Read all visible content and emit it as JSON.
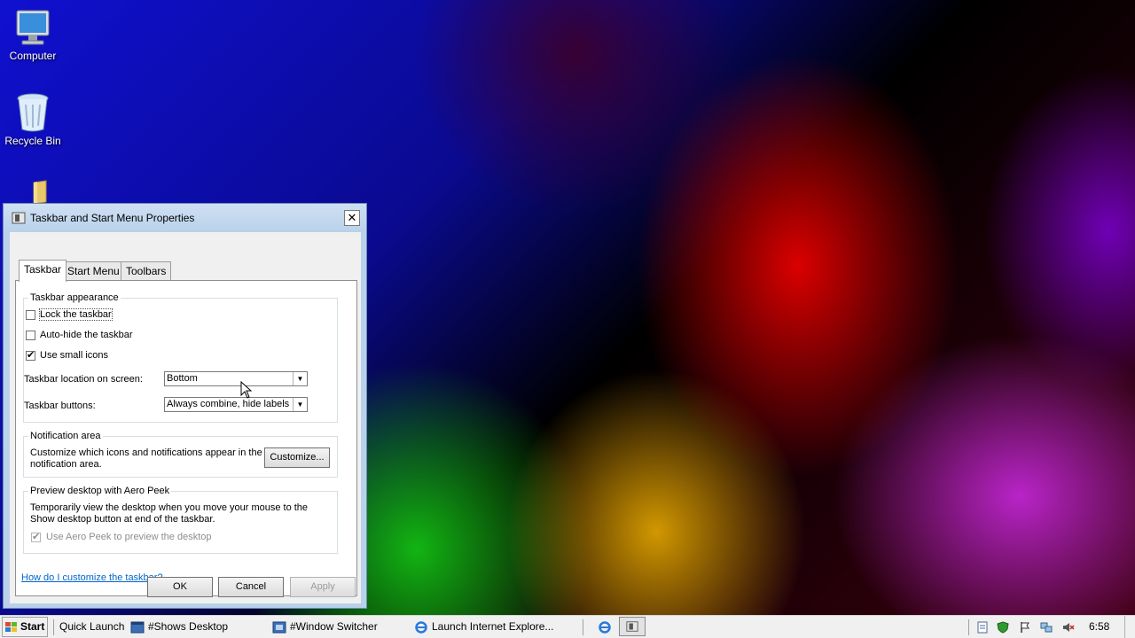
{
  "desktop": {
    "icons": [
      {
        "label": "Computer",
        "icon": "computer-icon"
      },
      {
        "label": "Recycle Bin",
        "icon": "recycle-bin-icon"
      },
      {
        "label": "",
        "icon": "folder-icon"
      }
    ]
  },
  "dialog": {
    "title": "Taskbar and Start Menu Properties",
    "close_label": "✕",
    "tabs": [
      {
        "label": "Taskbar",
        "active": true
      },
      {
        "label": "Start Menu",
        "active": false
      },
      {
        "label": "Toolbars",
        "active": false
      }
    ],
    "appearance": {
      "legend": "Taskbar appearance",
      "lock_label": "Lock the taskbar",
      "lock_checked": false,
      "autohide_label": "Auto-hide the taskbar",
      "autohide_checked": false,
      "small_icons_label": "Use small icons",
      "small_icons_checked": true,
      "location_label": "Taskbar location on screen:",
      "location_value": "Bottom",
      "buttons_label": "Taskbar buttons:",
      "buttons_value": "Always combine, hide labels"
    },
    "notification": {
      "legend": "Notification area",
      "text_line1": "Customize which icons and notifications appear in the",
      "text_line2": "notification area.",
      "customize_label": "Customize..."
    },
    "aero_peek": {
      "legend": "Preview desktop with Aero Peek",
      "text_line1": "Temporarily view the desktop when you move your mouse to the",
      "text_line2": "Show desktop button at end of the taskbar.",
      "use_label": "Use Aero Peek to preview the desktop",
      "use_checked": true,
      "use_disabled": true
    },
    "help_link": "How do I customize the taskbar?",
    "ok_label": "OK",
    "cancel_label": "Cancel",
    "apply_label": "Apply",
    "check_glyph": "✔"
  },
  "taskbar": {
    "start_label": "Start",
    "quick_launch_label": "Quick Launch",
    "items": [
      {
        "label": "#Shows Desktop"
      },
      {
        "label": "#Window Switcher"
      },
      {
        "label": "Launch Internet Explore..."
      }
    ],
    "clock": "6:58"
  }
}
